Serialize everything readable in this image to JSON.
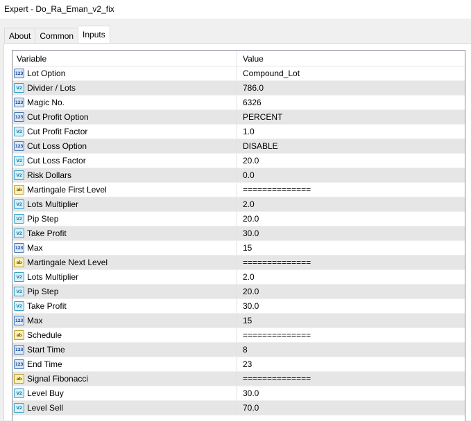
{
  "window": {
    "title": "Expert - Do_Ra_Eman_v2_fix"
  },
  "tabs": [
    {
      "label": "About",
      "active": false
    },
    {
      "label": "Common",
      "active": false
    },
    {
      "label": "Inputs",
      "active": true
    }
  ],
  "grid": {
    "headers": {
      "variable": "Variable",
      "value": "Value"
    },
    "icon_labels": {
      "int": "123",
      "double": "V2",
      "string": "ab"
    },
    "rows": [
      {
        "type": "int",
        "icon": "int-icon",
        "variable": "Lot Option",
        "value": "Compound_Lot"
      },
      {
        "type": "double",
        "icon": "double-icon",
        "variable": "Divider / Lots",
        "value": "786.0"
      },
      {
        "type": "int",
        "icon": "int-icon",
        "variable": "Magic No.",
        "value": "6326"
      },
      {
        "type": "int",
        "icon": "int-icon",
        "variable": "Cut Profit Option",
        "value": "PERCENT"
      },
      {
        "type": "double",
        "icon": "double-icon",
        "variable": "Cut Profit Factor",
        "value": "1.0"
      },
      {
        "type": "int",
        "icon": "int-icon",
        "variable": "Cut Loss Option",
        "value": "DISABLE"
      },
      {
        "type": "double",
        "icon": "double-icon",
        "variable": "Cut Loss Factor",
        "value": "20.0"
      },
      {
        "type": "double",
        "icon": "double-icon",
        "variable": "Risk Dollars",
        "value": "0.0"
      },
      {
        "type": "string",
        "icon": "string-icon",
        "variable": "Martingale First Level",
        "value": "=============="
      },
      {
        "type": "double",
        "icon": "double-icon",
        "variable": "Lots Multiplier",
        "value": "2.0"
      },
      {
        "type": "double",
        "icon": "double-icon",
        "variable": "Pip Step",
        "value": "20.0"
      },
      {
        "type": "double",
        "icon": "double-icon",
        "variable": "Take Profit",
        "value": "30.0"
      },
      {
        "type": "int",
        "icon": "int-icon",
        "variable": "Max",
        "value": "15"
      },
      {
        "type": "string",
        "icon": "string-icon",
        "variable": "Martingale Next Level",
        "value": "=============="
      },
      {
        "type": "double",
        "icon": "double-icon",
        "variable": "Lots Multiplier",
        "value": "2.0"
      },
      {
        "type": "double",
        "icon": "double-icon",
        "variable": "Pip Step",
        "value": "20.0"
      },
      {
        "type": "double",
        "icon": "double-icon",
        "variable": "Take Profit",
        "value": "30.0"
      },
      {
        "type": "int",
        "icon": "int-icon",
        "variable": "Max",
        "value": "15"
      },
      {
        "type": "string",
        "icon": "string-icon",
        "variable": "Schedule",
        "value": "=============="
      },
      {
        "type": "int",
        "icon": "int-icon",
        "variable": "Start Time",
        "value": "8"
      },
      {
        "type": "int",
        "icon": "int-icon",
        "variable": "End Time",
        "value": "23"
      },
      {
        "type": "string",
        "icon": "string-icon",
        "variable": "Signal Fibonacci",
        "value": "=============="
      },
      {
        "type": "double",
        "icon": "double-icon",
        "variable": "Level Buy",
        "value": "30.0"
      },
      {
        "type": "double",
        "icon": "double-icon",
        "variable": "Level Sell",
        "value": "70.0"
      }
    ]
  }
}
